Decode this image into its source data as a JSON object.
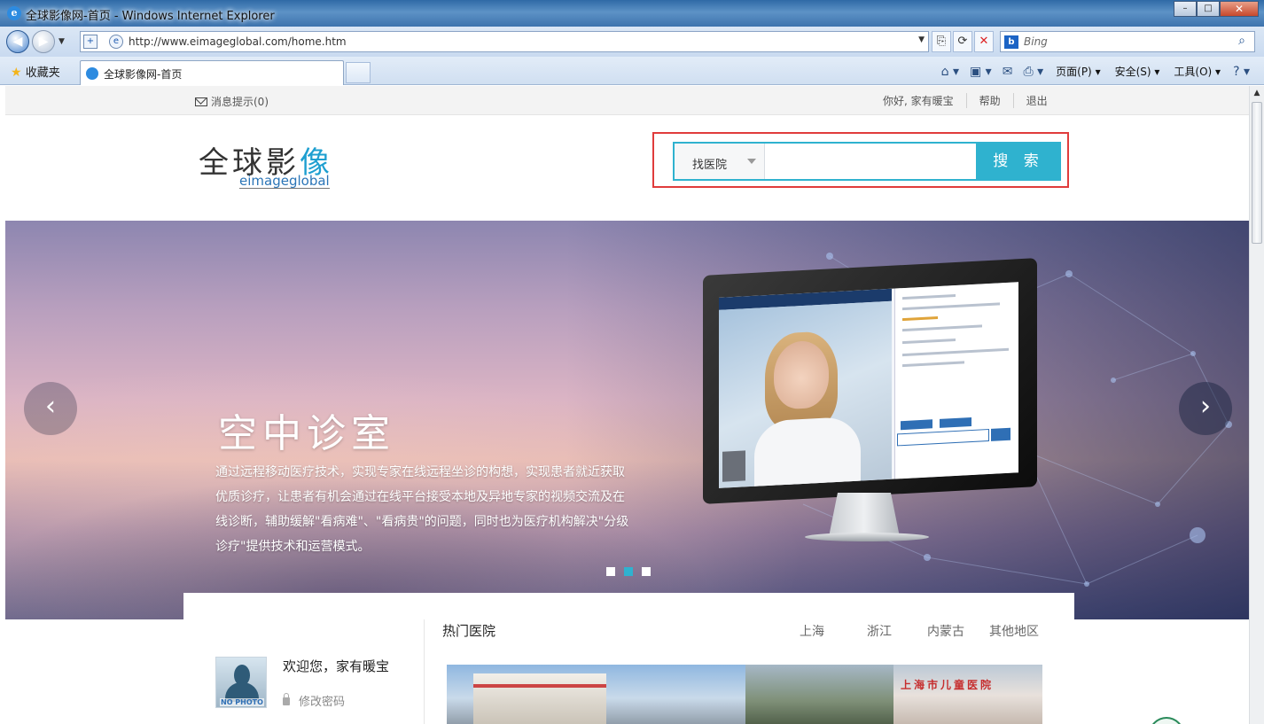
{
  "browser": {
    "window_title": "全球影像网-首页 - Windows Internet Explorer",
    "url": "http://www.eimageglobal.com/home.htm",
    "search_provider": "Bing",
    "favorites_label": "收藏夹",
    "tab_title": "全球影像网-首页",
    "commands": {
      "page": "页面(P)",
      "safety": "安全(S)",
      "tools": "工具(O)"
    }
  },
  "topnav": {
    "messages": "消息提示(0)",
    "greeting": "你好, 家有暖宝",
    "help": "帮助",
    "logout": "退出"
  },
  "logo": {
    "cn_main": "全球影",
    "cn_accent": "像",
    "en": "eimageglobal"
  },
  "search": {
    "category": "找医院",
    "button": "搜 索",
    "value": ""
  },
  "banner": {
    "title": "空中诊室",
    "text": "通过远程移动医疗技术，实现专家在线远程坐诊的构想，实现患者就近获取优质诊疗，让患者有机会通过在线平台接受本地及异地专家的视频交流及在线诊断，辅助缓解\"看病难\"、\"看病贵\"的问题，同时也为医疗机构解决\"分级诊疗\"提供技术和运营模式。",
    "active_slide": 2,
    "slide_count": 3,
    "accent_color": "#2fb2cf"
  },
  "user": {
    "avatar_label": "NO PHOTO",
    "welcome": "欢迎您，家有暖宝",
    "change_password": "修改密码"
  },
  "hospitals": {
    "title": "热门医院",
    "regions": [
      "上海",
      "浙江",
      "内蒙古",
      "其他地区"
    ],
    "image3_sign": "上海市儿童医院"
  }
}
